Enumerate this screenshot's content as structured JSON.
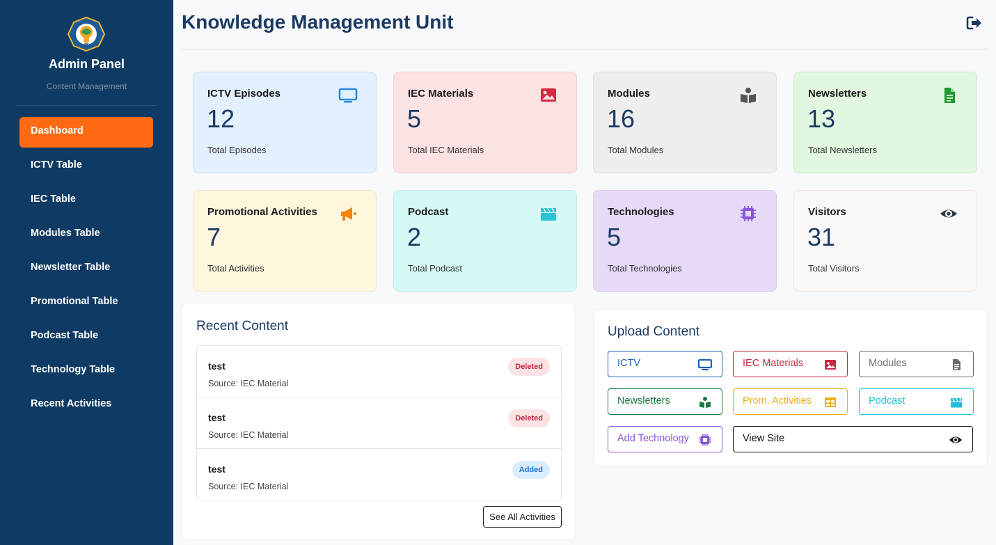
{
  "sidebar": {
    "brand": "Admin Panel",
    "subtitle": "Content Management",
    "items": [
      {
        "label": "Dashboard",
        "active": true
      },
      {
        "label": "ICTV Table"
      },
      {
        "label": "IEC Table"
      },
      {
        "label": "Modules Table"
      },
      {
        "label": "Newsletter Table"
      },
      {
        "label": "Promotional Table"
      },
      {
        "label": "Podcast Table"
      },
      {
        "label": "Technology Table"
      },
      {
        "label": "Recent Activities"
      }
    ]
  },
  "header": {
    "title": "Knowledge Management Unit",
    "logout_icon": "sign-out-icon"
  },
  "cards": [
    {
      "title": "ICTV Episodes",
      "value": "12",
      "sub": "Total Episodes",
      "icon": "tv-icon",
      "bg": "#e3f0fd",
      "accent": "#2a8ae3"
    },
    {
      "title": "IEC Materials",
      "value": "5",
      "sub": "Total IEC Materials",
      "icon": "image-icon",
      "bg": "#fde2e4",
      "accent": "#d8283e"
    },
    {
      "title": "Modules",
      "value": "16",
      "sub": "Total Modules",
      "icon": "book-reader-icon",
      "bg": "#eeeeee",
      "accent": "#555555"
    },
    {
      "title": "Newsletters",
      "value": "13",
      "sub": "Total Newsletters",
      "icon": "file-icon",
      "bg": "#e1f7df",
      "accent": "#1f9a30"
    },
    {
      "title": "Promotional Activities",
      "value": "7",
      "sub": "Total Activities",
      "icon": "megaphone-icon",
      "bg": "#fef7dd",
      "accent": "#f2840e"
    },
    {
      "title": "Podcast",
      "value": "2",
      "sub": "Total Podcast",
      "icon": "clapperboard-icon",
      "bg": "#d5faf6",
      "accent": "#2cc4d6"
    },
    {
      "title": "Technologies",
      "value": "5",
      "sub": "Total Technologies",
      "icon": "chip-icon",
      "bg": "#e6daf8",
      "accent": "#8a55d8"
    },
    {
      "title": "Visitors",
      "value": "31",
      "sub": "Total Visitors",
      "icon": "eye-icon",
      "bg": "#fcf8f7",
      "accent": "#2a3a40"
    }
  ],
  "recent": {
    "title": "Recent Content",
    "items": [
      {
        "name": "test",
        "source": "Source: IEC Material",
        "badge": "Deleted",
        "type": "deleted"
      },
      {
        "name": "test",
        "source": "Source: IEC Material",
        "badge": "Deleted",
        "type": "deleted"
      },
      {
        "name": "test",
        "source": "Source: IEC Material",
        "badge": "Added",
        "type": "added"
      }
    ],
    "see_all": "See All Activities"
  },
  "upload": {
    "title": "Upload Content",
    "buttons": [
      {
        "label": "ICTV",
        "icon": "tv-icon",
        "color": "#1b62b8"
      },
      {
        "label": "IEC Materials",
        "icon": "image-icon",
        "color": "#c62840"
      },
      {
        "label": "Modules",
        "icon": "file-icon",
        "color": "#6b6b6b"
      },
      {
        "label": "Newsletters",
        "icon": "book-reader-icon",
        "color": "#1b7a42"
      },
      {
        "label": "Prom. Activities",
        "icon": "table-icon",
        "color": "#e8b21b"
      },
      {
        "label": "Podcast",
        "icon": "clapperboard-icon",
        "color": "#1fbfd8"
      },
      {
        "label": "Add Technology",
        "icon": "chip-icon",
        "color": "#8a55d8"
      },
      {
        "label": "View Site",
        "icon": "eye-icon",
        "color": "#111111"
      }
    ]
  }
}
